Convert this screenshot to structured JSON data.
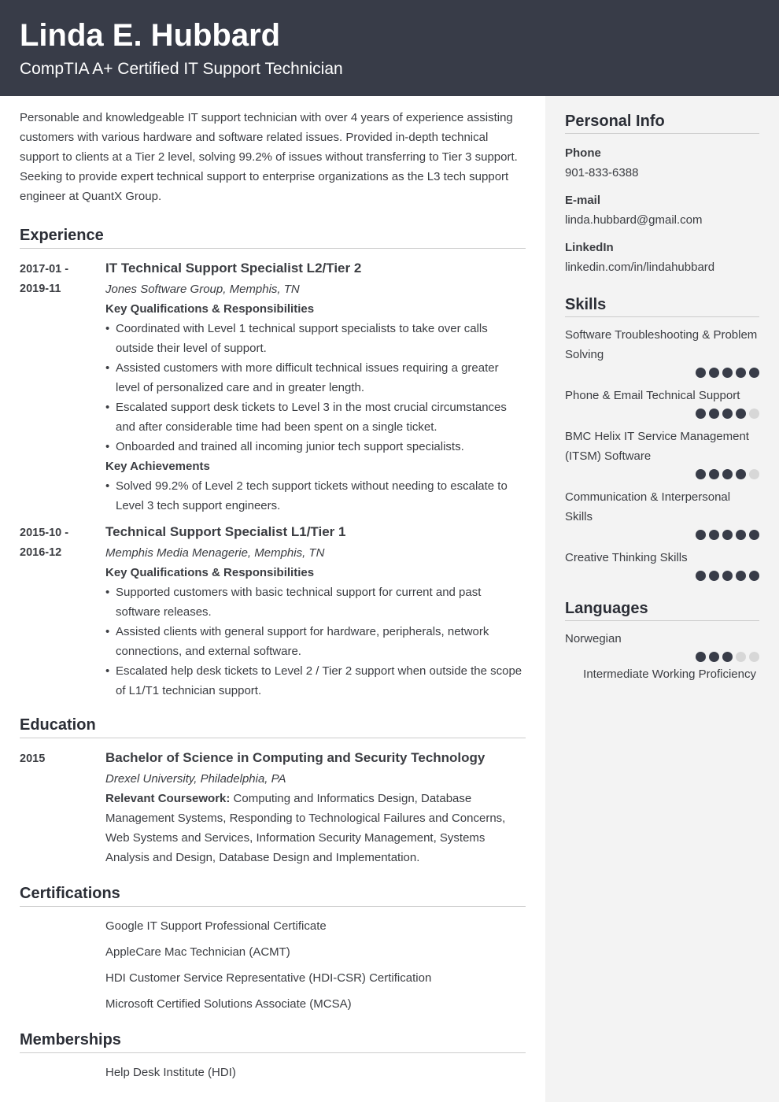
{
  "header": {
    "name": "Linda E. Hubbard",
    "title": "CompTIA A+ Certified IT Support Technician"
  },
  "summary": "Personable and knowledgeable IT support technician with over 4 years of experience assisting customers with various hardware and software related issues. Provided in-depth technical support to clients at a Tier 2 level, solving 99.2% of issues without transferring to Tier 3 support. Seeking to provide expert technical support to enterprise organizations as the L3 tech support engineer at QuantX Group.",
  "experience": {
    "title": "Experience",
    "entries": [
      {
        "date_start": "2017-01 -",
        "date_end": "2019-11",
        "role": "IT Technical Support Specialist L2/Tier 2",
        "org": "Jones Software Group, Memphis, TN",
        "resp_heading": "Key Qualifications & Responsibilities",
        "responsibilities": [
          "Coordinated with Level 1 technical support specialists to take over calls outside their level of support.",
          "Assisted customers with more difficult technical issues requiring a greater level of personalized care and in greater length.",
          "Escalated support desk tickets to Level 3 in the most crucial circumstances and after considerable time had been spent on a single ticket.",
          "Onboarded and trained all incoming junior tech support specialists."
        ],
        "ach_heading": "Key Achievements",
        "achievements": [
          "Solved 99.2% of Level 2 tech support tickets without needing to escalate to Level 3 tech support engineers."
        ]
      },
      {
        "date_start": "2015-10 -",
        "date_end": "2016-12",
        "role": "Technical Support Specialist L1/Tier 1",
        "org": "Memphis Media Menagerie, Memphis, TN",
        "resp_heading": "Key Qualifications & Responsibilities",
        "responsibilities": [
          "Supported customers with basic technical support for current and past software releases.",
          "Assisted clients with general support for hardware, peripherals, network connections, and external software.",
          "Escalated help desk tickets to Level 2 / Tier 2 support when outside the scope of L1/T1 technician support."
        ]
      }
    ]
  },
  "education": {
    "title": "Education",
    "entries": [
      {
        "date": "2015",
        "degree": "Bachelor of Science in Computing and Security Technology",
        "school": "Drexel University, Philadelphia, PA",
        "coursework_label": "Relevant Coursework:",
        "coursework": " Computing and Informatics Design, Database Management Systems, Responding to Technological Failures and Concerns, Web Systems and Services, Information Security Management, Systems Analysis and Design, Database Design and Implementation."
      }
    ]
  },
  "certifications": {
    "title": "Certifications",
    "items": [
      "Google IT Support Professional Certificate",
      "AppleCare Mac Technician (ACMT)",
      "HDI Customer Service Representative (HDI-CSR) Certification",
      "Microsoft Certified Solutions Associate (MCSA)"
    ]
  },
  "memberships": {
    "title": "Memberships",
    "items": [
      "Help Desk Institute (HDI)"
    ]
  },
  "sidebar": {
    "personal_info": {
      "title": "Personal Info",
      "fields": [
        {
          "label": "Phone",
          "value": "901-833-6388"
        },
        {
          "label": "E-mail",
          "value": "linda.hubbard@gmail.com"
        },
        {
          "label": "LinkedIn",
          "value": "linkedin.com/in/lindahubbard"
        }
      ]
    },
    "skills": {
      "title": "Skills",
      "items": [
        {
          "label": "Software Troubleshooting & Problem Solving",
          "rating": 5,
          "max": 5
        },
        {
          "label": "Phone & Email Technical Support",
          "rating": 4,
          "max": 5
        },
        {
          "label": "BMC Helix IT Service Management (ITSM) Software",
          "rating": 4,
          "max": 5
        },
        {
          "label": "Communication & Interpersonal Skills",
          "rating": 5,
          "max": 5
        },
        {
          "label": "Creative Thinking Skills",
          "rating": 5,
          "max": 5
        }
      ]
    },
    "languages": {
      "title": "Languages",
      "items": [
        {
          "label": "Norwegian",
          "rating": 3,
          "max": 5,
          "level": "Intermediate Working Proficiency"
        }
      ]
    }
  },
  "colors": {
    "header_bg": "#383c48",
    "sidebar_bg": "#f3f3f3",
    "dot_on": "#383c48",
    "dot_off": "#d7d7d7"
  }
}
